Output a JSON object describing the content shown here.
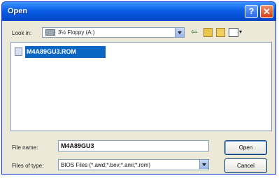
{
  "window": {
    "title": "Open"
  },
  "titlebar": {
    "help": "?",
    "close": "✕"
  },
  "lookin": {
    "label": "Look in:",
    "value": "3½ Floppy (A:)"
  },
  "files": [
    {
      "name": "M4A89GU3.ROM"
    }
  ],
  "filename": {
    "label": "File name:",
    "value": "M4A89GU3"
  },
  "filetype": {
    "label": "Files of type:",
    "value": "BIOS Files (*.awd;*.bev;*.ami;*.rom)"
  },
  "buttons": {
    "open": "Open",
    "cancel": "Cancel"
  },
  "toolbar": {
    "views_arrow": "▾"
  }
}
